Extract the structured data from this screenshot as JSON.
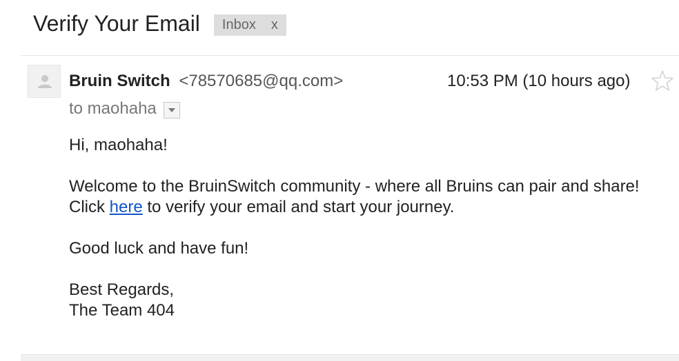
{
  "email": {
    "subject": "Verify Your Email",
    "label": "Inbox",
    "label_remove": "x",
    "sender_name": "Bruin Switch",
    "sender_email": "<78570685@qq.com>",
    "timestamp": "10:53 PM (10 hours ago)",
    "recipient": "to maohaha",
    "body": {
      "greeting": "Hi, maohaha!",
      "line1": "Welcome to the BruinSwitch community - where all Bruins can pair and share!",
      "line2_prefix": "Click",
      "line2_link": "here",
      "line2_suffix": "to verify your email and start your journey.",
      "line3": "Good luck and have fun!",
      "signoff1": "Best Regards,",
      "signoff2": "The Team 404"
    }
  },
  "icons": {
    "avatar": "person-icon",
    "star": "star-icon",
    "details": "dropdown-arrow-icon"
  },
  "colors": {
    "link": "#1155cc",
    "label_bg": "#dddddd",
    "muted_text": "#777777"
  }
}
